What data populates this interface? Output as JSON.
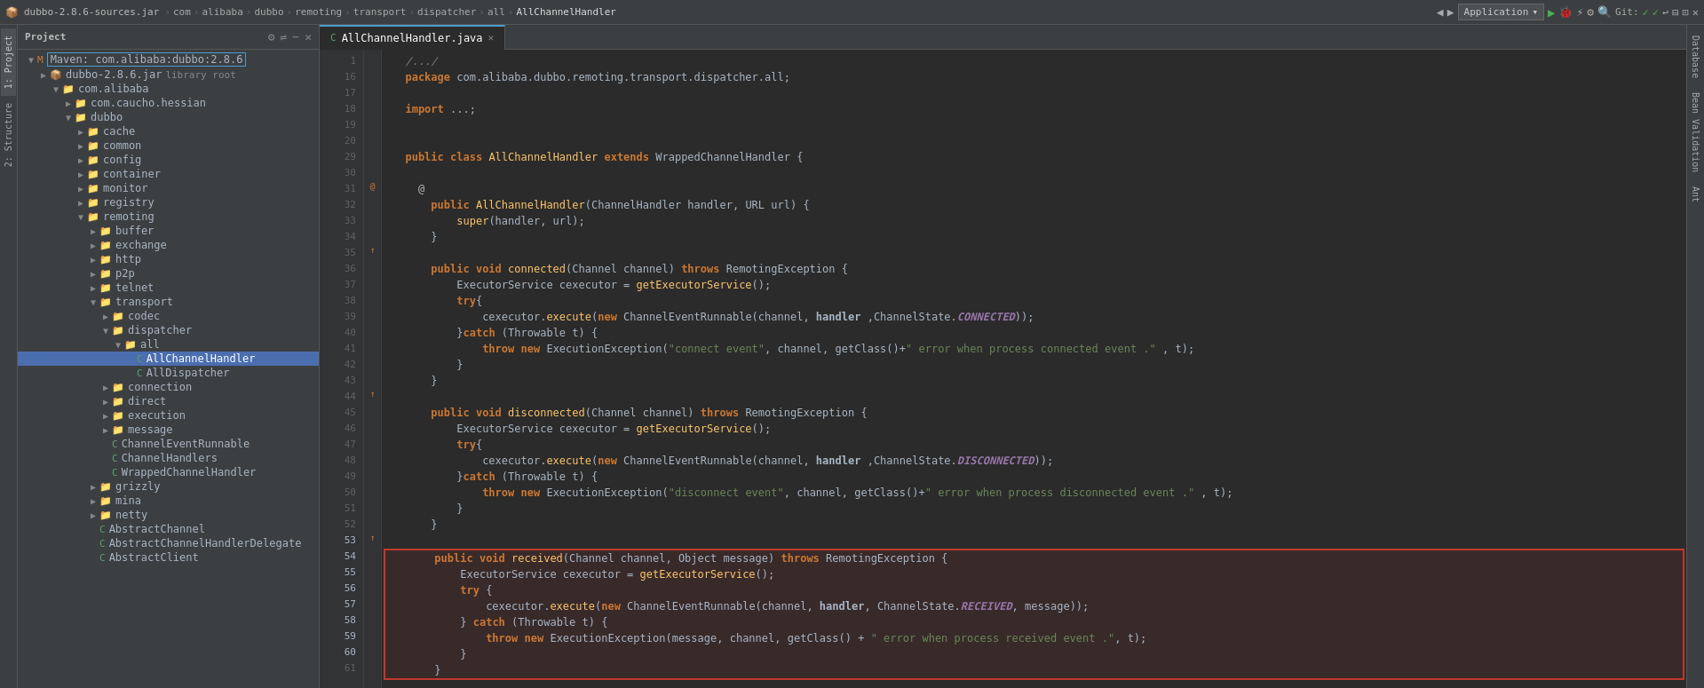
{
  "topbar": {
    "filename": "dubbo-2.8.6-sources.jar",
    "breadcrumbs": [
      "com",
      "alibaba",
      "dubbo",
      "remoting",
      "transport",
      "dispatcher",
      "all",
      "AllChannelHandler"
    ],
    "tab_label": "AllChannelHandler.java",
    "app_label": "Application",
    "git_label": "Git:"
  },
  "project": {
    "title": "Project",
    "root": {
      "label": "Maven: com.alibaba:dubbo:2.8.6",
      "children": [
        {
          "label": "dubbo-2.8.6.jar",
          "secondary": "library root",
          "type": "jar",
          "indent": 1
        },
        {
          "label": "com.alibaba",
          "type": "folder",
          "indent": 2,
          "expanded": true
        },
        {
          "label": "com.caucho.hessian",
          "type": "folder",
          "indent": 3
        },
        {
          "label": "dubbo",
          "type": "folder",
          "indent": 3,
          "expanded": true
        },
        {
          "label": "cache",
          "type": "folder",
          "indent": 4
        },
        {
          "label": "common",
          "type": "folder",
          "indent": 4
        },
        {
          "label": "config",
          "type": "folder",
          "indent": 4
        },
        {
          "label": "container",
          "type": "folder",
          "indent": 4
        },
        {
          "label": "monitor",
          "type": "folder",
          "indent": 4
        },
        {
          "label": "registry",
          "type": "folder",
          "indent": 4
        },
        {
          "label": "remoting",
          "type": "folder",
          "indent": 4,
          "expanded": true
        },
        {
          "label": "buffer",
          "type": "folder",
          "indent": 5
        },
        {
          "label": "exchange",
          "type": "folder",
          "indent": 5
        },
        {
          "label": "http",
          "type": "folder",
          "indent": 5
        },
        {
          "label": "p2p",
          "type": "folder",
          "indent": 5
        },
        {
          "label": "telnet",
          "type": "folder",
          "indent": 5
        },
        {
          "label": "transport",
          "type": "folder",
          "indent": 5,
          "expanded": true
        },
        {
          "label": "codec",
          "type": "folder",
          "indent": 6
        },
        {
          "label": "dispatcher",
          "type": "folder",
          "indent": 6,
          "expanded": true
        },
        {
          "label": "all",
          "type": "folder",
          "indent": 7,
          "expanded": true
        },
        {
          "label": "AllChannelHandler",
          "type": "file-java",
          "indent": 8,
          "selected": true
        },
        {
          "label": "AllDispatcher",
          "type": "file-java",
          "indent": 8
        },
        {
          "label": "connection",
          "type": "folder",
          "indent": 6
        },
        {
          "label": "direct",
          "type": "folder",
          "indent": 6
        },
        {
          "label": "execution",
          "type": "folder",
          "indent": 6
        },
        {
          "label": "message",
          "type": "folder",
          "indent": 6
        },
        {
          "label": "ChannelEventRunnable",
          "type": "file-java",
          "indent": 6
        },
        {
          "label": "ChannelHandlers",
          "type": "file-java",
          "indent": 6
        },
        {
          "label": "WrappedChannelHandler",
          "type": "file-java",
          "indent": 6
        },
        {
          "label": "grizzly",
          "type": "folder",
          "indent": 5
        },
        {
          "label": "mina",
          "type": "folder",
          "indent": 5
        },
        {
          "label": "netty",
          "type": "folder",
          "indent": 5
        },
        {
          "label": "AbstractChannel",
          "type": "file-java",
          "indent": 5
        },
        {
          "label": "AbstractChannelHandlerDelegate",
          "type": "file-java",
          "indent": 5
        },
        {
          "label": "AbstractClient",
          "type": "file-java",
          "indent": 5
        }
      ]
    }
  },
  "editor": {
    "lines": [
      {
        "num": 1,
        "content": "  /.../"
      },
      {
        "num": 16,
        "content": "  package com.alibaba.dubbo.remoting.transport.dispatcher.all;"
      },
      {
        "num": 17,
        "content": ""
      },
      {
        "num": 18,
        "content": "  import ...;"
      },
      {
        "num": 19,
        "content": ""
      },
      {
        "num": 20,
        "content": ""
      },
      {
        "num": 29,
        "content": "  public class AllChannelHandler extends WrappedChannelHandler {"
      },
      {
        "num": 30,
        "content": ""
      },
      {
        "num": 31,
        "content": "    @",
        "annotation": true
      },
      {
        "num": 31,
        "content": "      public AllChannelHandler(ChannelHandler handler, URL url) {"
      },
      {
        "num": 32,
        "content": "          super(handler, url);"
      },
      {
        "num": 33,
        "content": "      }"
      },
      {
        "num": 34,
        "content": ""
      },
      {
        "num": 35,
        "content": "      public void connected(Channel channel) throws RemotingException {",
        "arrow": true
      },
      {
        "num": 36,
        "content": "          ExecutorService cexecutor = getExecutorService();"
      },
      {
        "num": 37,
        "content": "          try{"
      },
      {
        "num": 38,
        "content": "              cexecutor.execute(new ChannelEventRunnable(channel, handler ,ChannelState.CONNECTED));"
      },
      {
        "num": 39,
        "content": "          }catch (Throwable t) {"
      },
      {
        "num": 40,
        "content": "              throw new ExecutionException(\"connect event\", channel, getClass()+\" error when process connected event .\" , t);"
      },
      {
        "num": 41,
        "content": "          }"
      },
      {
        "num": 42,
        "content": "      }"
      },
      {
        "num": 43,
        "content": ""
      },
      {
        "num": 44,
        "content": "      public void disconnected(Channel channel) throws RemotingException {",
        "arrow": true
      },
      {
        "num": 45,
        "content": "          ExecutorService cexecutor = getExecutorService();"
      },
      {
        "num": 46,
        "content": "          try{"
      },
      {
        "num": 47,
        "content": "              cexecutor.execute(new ChannelEventRunnable(channel, handler ,ChannelState.DISCONNECTED));"
      },
      {
        "num": 48,
        "content": "          }catch (Throwable t) {"
      },
      {
        "num": 49,
        "content": "              throw new ExecutionException(\"disconnect event\", channel, getClass()+\" error when process disconnected event .\" , t);"
      },
      {
        "num": 50,
        "content": "          }"
      },
      {
        "num": 51,
        "content": "      }"
      },
      {
        "num": 52,
        "content": ""
      },
      {
        "num": 53,
        "content": "      public void received(Channel channel, Object message) throws RemotingException {",
        "arrow": true,
        "highlight": true
      },
      {
        "num": 54,
        "content": "          ExecutorService cexecutor = getExecutorService();",
        "highlight": true
      },
      {
        "num": 55,
        "content": "          try {",
        "highlight": true
      },
      {
        "num": 56,
        "content": "              cexecutor.execute(new ChannelEventRunnable(channel, handler, ChannelState.RECEIVED, message));",
        "highlight": true
      },
      {
        "num": 57,
        "content": "          } catch (Throwable t) {",
        "highlight": true
      },
      {
        "num": 58,
        "content": "              throw new ExecutionException(message, channel, getClass() + \" error when process received event .\", t);",
        "highlight": true
      },
      {
        "num": 59,
        "content": "          }",
        "highlight": true
      },
      {
        "num": 60,
        "content": "      }",
        "highlight": true
      },
      {
        "num": 61,
        "content": ""
      }
    ]
  },
  "right_tabs": {
    "database": "Database",
    "bean_validation": "Bean Validation",
    "ant": "Ant"
  }
}
